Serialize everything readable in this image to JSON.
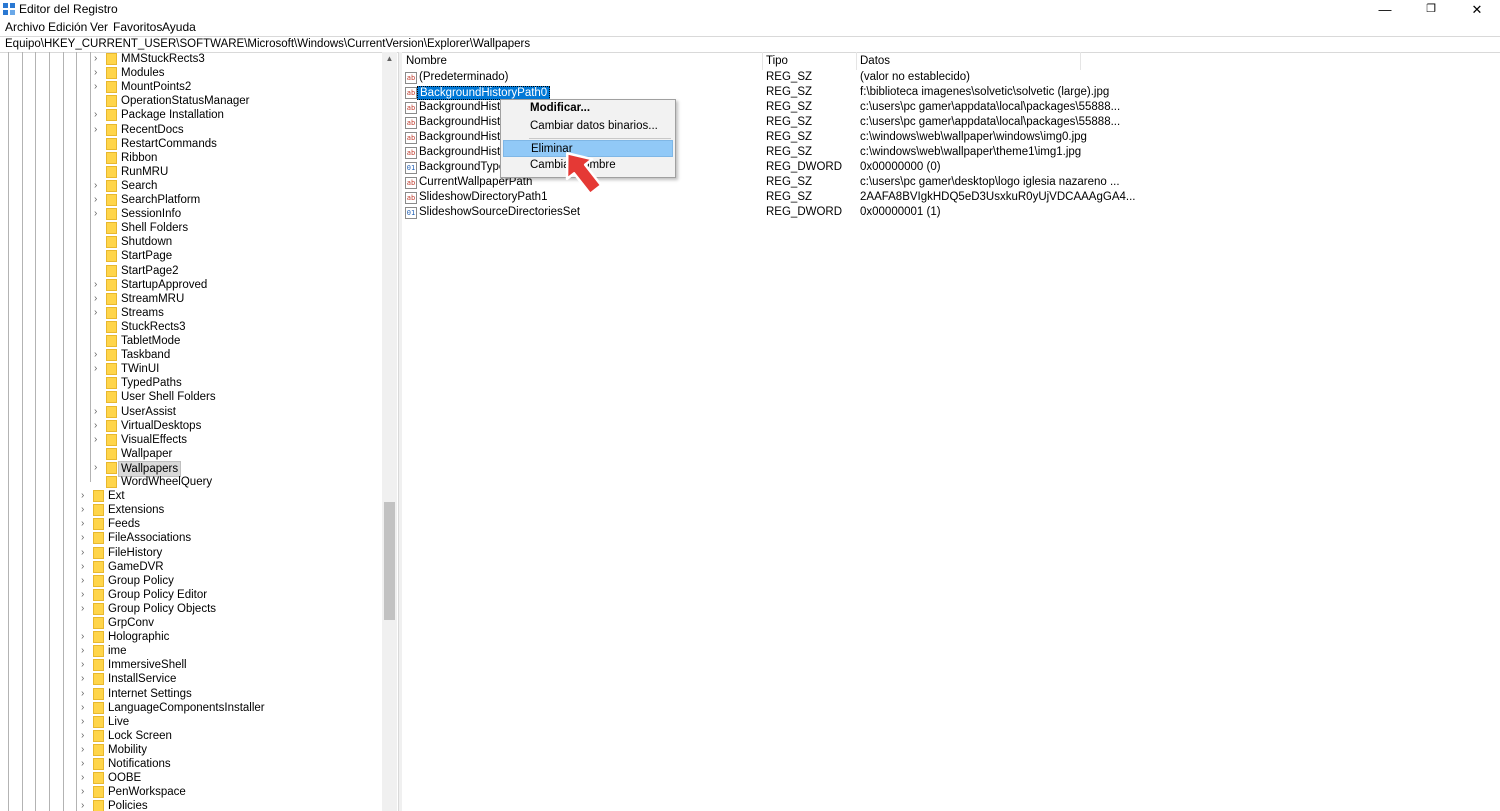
{
  "window": {
    "title": "Editor del Registro",
    "minimize_glyph": "—",
    "restore_glyph": "❐",
    "close_glyph": "✕"
  },
  "menu": [
    "Archivo",
    "Edición",
    "Ver",
    "Favoritos",
    "Ayuda"
  ],
  "address": "Equipo\\HKEY_CURRENT_USER\\SOFTWARE\\Microsoft\\Windows\\CurrentVersion\\Explorer\\Wallpapers",
  "tree": {
    "deep_items": [
      "MMStuckRects3",
      "Modules",
      "MountPoints2",
      "OperationStatusManager",
      "Package Installation",
      "RecentDocs",
      "RestartCommands",
      "Ribbon",
      "RunMRU",
      "Search",
      "SearchPlatform",
      "SessionInfo",
      "Shell Folders",
      "Shutdown",
      "StartPage",
      "StartPage2",
      "StartupApproved",
      "StreamMRU",
      "Streams",
      "StuckRects3",
      "TabletMode",
      "Taskband",
      "TWinUI",
      "TypedPaths",
      "User Shell Folders",
      "UserAssist",
      "VirtualDesktops",
      "VisualEffects",
      "Wallpaper",
      "Wallpapers",
      "WordWheelQuery"
    ],
    "deep_has_children": [
      true,
      true,
      true,
      false,
      true,
      true,
      false,
      false,
      false,
      true,
      true,
      true,
      false,
      false,
      false,
      false,
      true,
      true,
      true,
      false,
      false,
      true,
      true,
      false,
      false,
      true,
      true,
      true,
      false,
      true,
      false
    ],
    "selected_index": 29,
    "shallow_items": [
      "Ext",
      "Extensions",
      "Feeds",
      "FileAssociations",
      "FileHistory",
      "GameDVR",
      "Group Policy",
      "Group Policy Editor",
      "Group Policy Objects",
      "GrpConv",
      "Holographic",
      "ime",
      "ImmersiveShell",
      "InstallService",
      "Internet Settings",
      "LanguageComponentsInstaller",
      "Live",
      "Lock Screen",
      "Mobility",
      "Notifications",
      "OOBE",
      "PenWorkspace",
      "Policies"
    ],
    "shallow_has_children": [
      true,
      true,
      true,
      true,
      true,
      true,
      true,
      true,
      true,
      false,
      true,
      true,
      true,
      true,
      true,
      true,
      true,
      true,
      true,
      true,
      true,
      true,
      true
    ]
  },
  "list": {
    "columns": [
      "Nombre",
      "Tipo",
      "Datos"
    ],
    "rows": [
      {
        "name": "(Predeterminado)",
        "type": "REG_SZ",
        "data": "(valor no establecido)",
        "icon": "ab"
      },
      {
        "name": "BackgroundHistoryPath0",
        "type": "REG_SZ",
        "data": "f:\\biblioteca imagenes\\solvetic\\solvetic (large).jpg",
        "icon": "ab"
      },
      {
        "name": "BackgroundHistoryPath1",
        "type": "REG_SZ",
        "data": "c:\\users\\pc gamer\\appdata\\local\\packages\\55888...",
        "icon": "ab"
      },
      {
        "name": "BackgroundHistoryPath2",
        "type": "REG_SZ",
        "data": "c:\\users\\pc gamer\\appdata\\local\\packages\\55888...",
        "icon": "ab"
      },
      {
        "name": "BackgroundHistoryPath3",
        "type": "REG_SZ",
        "data": "c:\\windows\\web\\wallpaper\\windows\\img0.jpg",
        "icon": "ab"
      },
      {
        "name": "BackgroundHistoryPath4",
        "type": "REG_SZ",
        "data": "c:\\windows\\web\\wallpaper\\theme1\\img1.jpg",
        "icon": "ab"
      },
      {
        "name": "BackgroundType",
        "type": "REG_DWORD",
        "data": "0x00000000 (0)",
        "icon": "dw"
      },
      {
        "name": "CurrentWallpaperPath",
        "type": "REG_SZ",
        "data": "c:\\users\\pc gamer\\desktop\\logo iglesia nazareno ...",
        "icon": "ab"
      },
      {
        "name": "SlideshowDirectoryPath1",
        "type": "REG_SZ",
        "data": "2AAFA8BVIgkHDQ5eD3UsxkuR0yUjVDCAAAgGA4...",
        "icon": "ab"
      },
      {
        "name": "SlideshowSourceDirectoriesSet",
        "type": "REG_DWORD",
        "data": "0x00000001 (1)",
        "icon": "dw"
      }
    ],
    "selected_index": 1
  },
  "context_menu": {
    "items": [
      "Modificar...",
      "Cambiar datos binarios...",
      "Eliminar",
      "Cambiar nombre"
    ],
    "default_index": 0,
    "highlighted_index": 2
  },
  "colors": {
    "selection": "#0078d7",
    "menu_highlight": "#91c9f7",
    "folder": "#ffd54a",
    "cursor": "#e53935"
  }
}
